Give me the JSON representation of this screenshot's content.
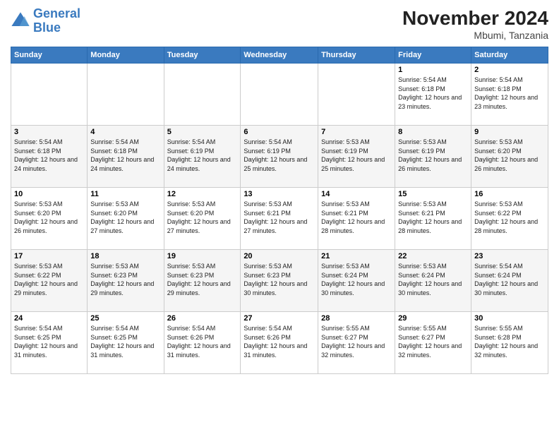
{
  "header": {
    "logo_line1": "General",
    "logo_line2": "Blue",
    "month_title": "November 2024",
    "location": "Mbumi, Tanzania"
  },
  "days_of_week": [
    "Sunday",
    "Monday",
    "Tuesday",
    "Wednesday",
    "Thursday",
    "Friday",
    "Saturday"
  ],
  "weeks": [
    [
      {
        "day": "",
        "info": ""
      },
      {
        "day": "",
        "info": ""
      },
      {
        "day": "",
        "info": ""
      },
      {
        "day": "",
        "info": ""
      },
      {
        "day": "",
        "info": ""
      },
      {
        "day": "1",
        "info": "Sunrise: 5:54 AM\nSunset: 6:18 PM\nDaylight: 12 hours and 23 minutes."
      },
      {
        "day": "2",
        "info": "Sunrise: 5:54 AM\nSunset: 6:18 PM\nDaylight: 12 hours and 23 minutes."
      }
    ],
    [
      {
        "day": "3",
        "info": "Sunrise: 5:54 AM\nSunset: 6:18 PM\nDaylight: 12 hours and 24 minutes."
      },
      {
        "day": "4",
        "info": "Sunrise: 5:54 AM\nSunset: 6:18 PM\nDaylight: 12 hours and 24 minutes."
      },
      {
        "day": "5",
        "info": "Sunrise: 5:54 AM\nSunset: 6:19 PM\nDaylight: 12 hours and 24 minutes."
      },
      {
        "day": "6",
        "info": "Sunrise: 5:54 AM\nSunset: 6:19 PM\nDaylight: 12 hours and 25 minutes."
      },
      {
        "day": "7",
        "info": "Sunrise: 5:53 AM\nSunset: 6:19 PM\nDaylight: 12 hours and 25 minutes."
      },
      {
        "day": "8",
        "info": "Sunrise: 5:53 AM\nSunset: 6:19 PM\nDaylight: 12 hours and 26 minutes."
      },
      {
        "day": "9",
        "info": "Sunrise: 5:53 AM\nSunset: 6:20 PM\nDaylight: 12 hours and 26 minutes."
      }
    ],
    [
      {
        "day": "10",
        "info": "Sunrise: 5:53 AM\nSunset: 6:20 PM\nDaylight: 12 hours and 26 minutes."
      },
      {
        "day": "11",
        "info": "Sunrise: 5:53 AM\nSunset: 6:20 PM\nDaylight: 12 hours and 27 minutes."
      },
      {
        "day": "12",
        "info": "Sunrise: 5:53 AM\nSunset: 6:20 PM\nDaylight: 12 hours and 27 minutes."
      },
      {
        "day": "13",
        "info": "Sunrise: 5:53 AM\nSunset: 6:21 PM\nDaylight: 12 hours and 27 minutes."
      },
      {
        "day": "14",
        "info": "Sunrise: 5:53 AM\nSunset: 6:21 PM\nDaylight: 12 hours and 28 minutes."
      },
      {
        "day": "15",
        "info": "Sunrise: 5:53 AM\nSunset: 6:21 PM\nDaylight: 12 hours and 28 minutes."
      },
      {
        "day": "16",
        "info": "Sunrise: 5:53 AM\nSunset: 6:22 PM\nDaylight: 12 hours and 28 minutes."
      }
    ],
    [
      {
        "day": "17",
        "info": "Sunrise: 5:53 AM\nSunset: 6:22 PM\nDaylight: 12 hours and 29 minutes."
      },
      {
        "day": "18",
        "info": "Sunrise: 5:53 AM\nSunset: 6:23 PM\nDaylight: 12 hours and 29 minutes."
      },
      {
        "day": "19",
        "info": "Sunrise: 5:53 AM\nSunset: 6:23 PM\nDaylight: 12 hours and 29 minutes."
      },
      {
        "day": "20",
        "info": "Sunrise: 5:53 AM\nSunset: 6:23 PM\nDaylight: 12 hours and 30 minutes."
      },
      {
        "day": "21",
        "info": "Sunrise: 5:53 AM\nSunset: 6:24 PM\nDaylight: 12 hours and 30 minutes."
      },
      {
        "day": "22",
        "info": "Sunrise: 5:53 AM\nSunset: 6:24 PM\nDaylight: 12 hours and 30 minutes."
      },
      {
        "day": "23",
        "info": "Sunrise: 5:54 AM\nSunset: 6:24 PM\nDaylight: 12 hours and 30 minutes."
      }
    ],
    [
      {
        "day": "24",
        "info": "Sunrise: 5:54 AM\nSunset: 6:25 PM\nDaylight: 12 hours and 31 minutes."
      },
      {
        "day": "25",
        "info": "Sunrise: 5:54 AM\nSunset: 6:25 PM\nDaylight: 12 hours and 31 minutes."
      },
      {
        "day": "26",
        "info": "Sunrise: 5:54 AM\nSunset: 6:26 PM\nDaylight: 12 hours and 31 minutes."
      },
      {
        "day": "27",
        "info": "Sunrise: 5:54 AM\nSunset: 6:26 PM\nDaylight: 12 hours and 31 minutes."
      },
      {
        "day": "28",
        "info": "Sunrise: 5:55 AM\nSunset: 6:27 PM\nDaylight: 12 hours and 32 minutes."
      },
      {
        "day": "29",
        "info": "Sunrise: 5:55 AM\nSunset: 6:27 PM\nDaylight: 12 hours and 32 minutes."
      },
      {
        "day": "30",
        "info": "Sunrise: 5:55 AM\nSunset: 6:28 PM\nDaylight: 12 hours and 32 minutes."
      }
    ]
  ]
}
